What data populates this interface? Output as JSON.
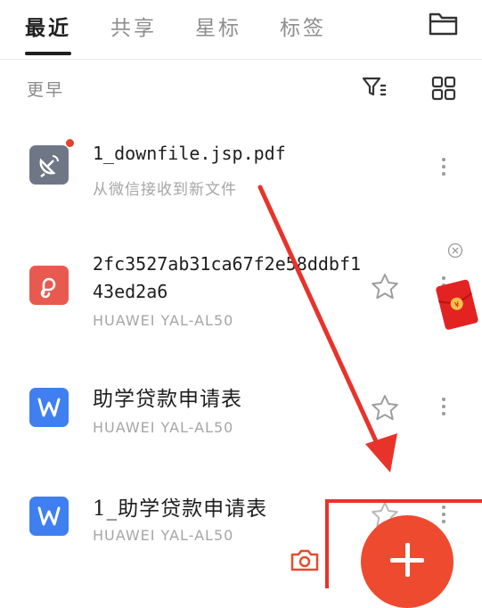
{
  "tabs": [
    {
      "label": "最近",
      "active": true
    },
    {
      "label": "共享",
      "active": false
    },
    {
      "label": "星标",
      "active": false
    },
    {
      "label": "标签",
      "active": false
    }
  ],
  "section_label": "更早",
  "files": [
    {
      "name": "1_downfile.jsp.pdf",
      "subtitle": "从微信接收到新文件",
      "icon": "satellite-dish-icon",
      "color": "#6f7787",
      "unread": true
    },
    {
      "name": "2fc3527ab31ca67f2e58ddbf1\n43ed2a6",
      "subtitle": "HUAWEI YAL-AL50",
      "icon": "pdf-link-icon",
      "color": "#e85a4f",
      "starred": false
    },
    {
      "name": "助学贷款申请表",
      "subtitle": "HUAWEI YAL-AL50",
      "icon": "word-doc-icon",
      "color": "#3f7ff0",
      "starred": false
    },
    {
      "name": "1_助学贷款申请表",
      "subtitle": "HUAWEI YAL-AL50",
      "icon": "word-doc-icon",
      "color": "#3f7ff0",
      "starred": false
    }
  ],
  "colors": {
    "accent": "#ee4a2f",
    "annotation": "#e8332b"
  }
}
